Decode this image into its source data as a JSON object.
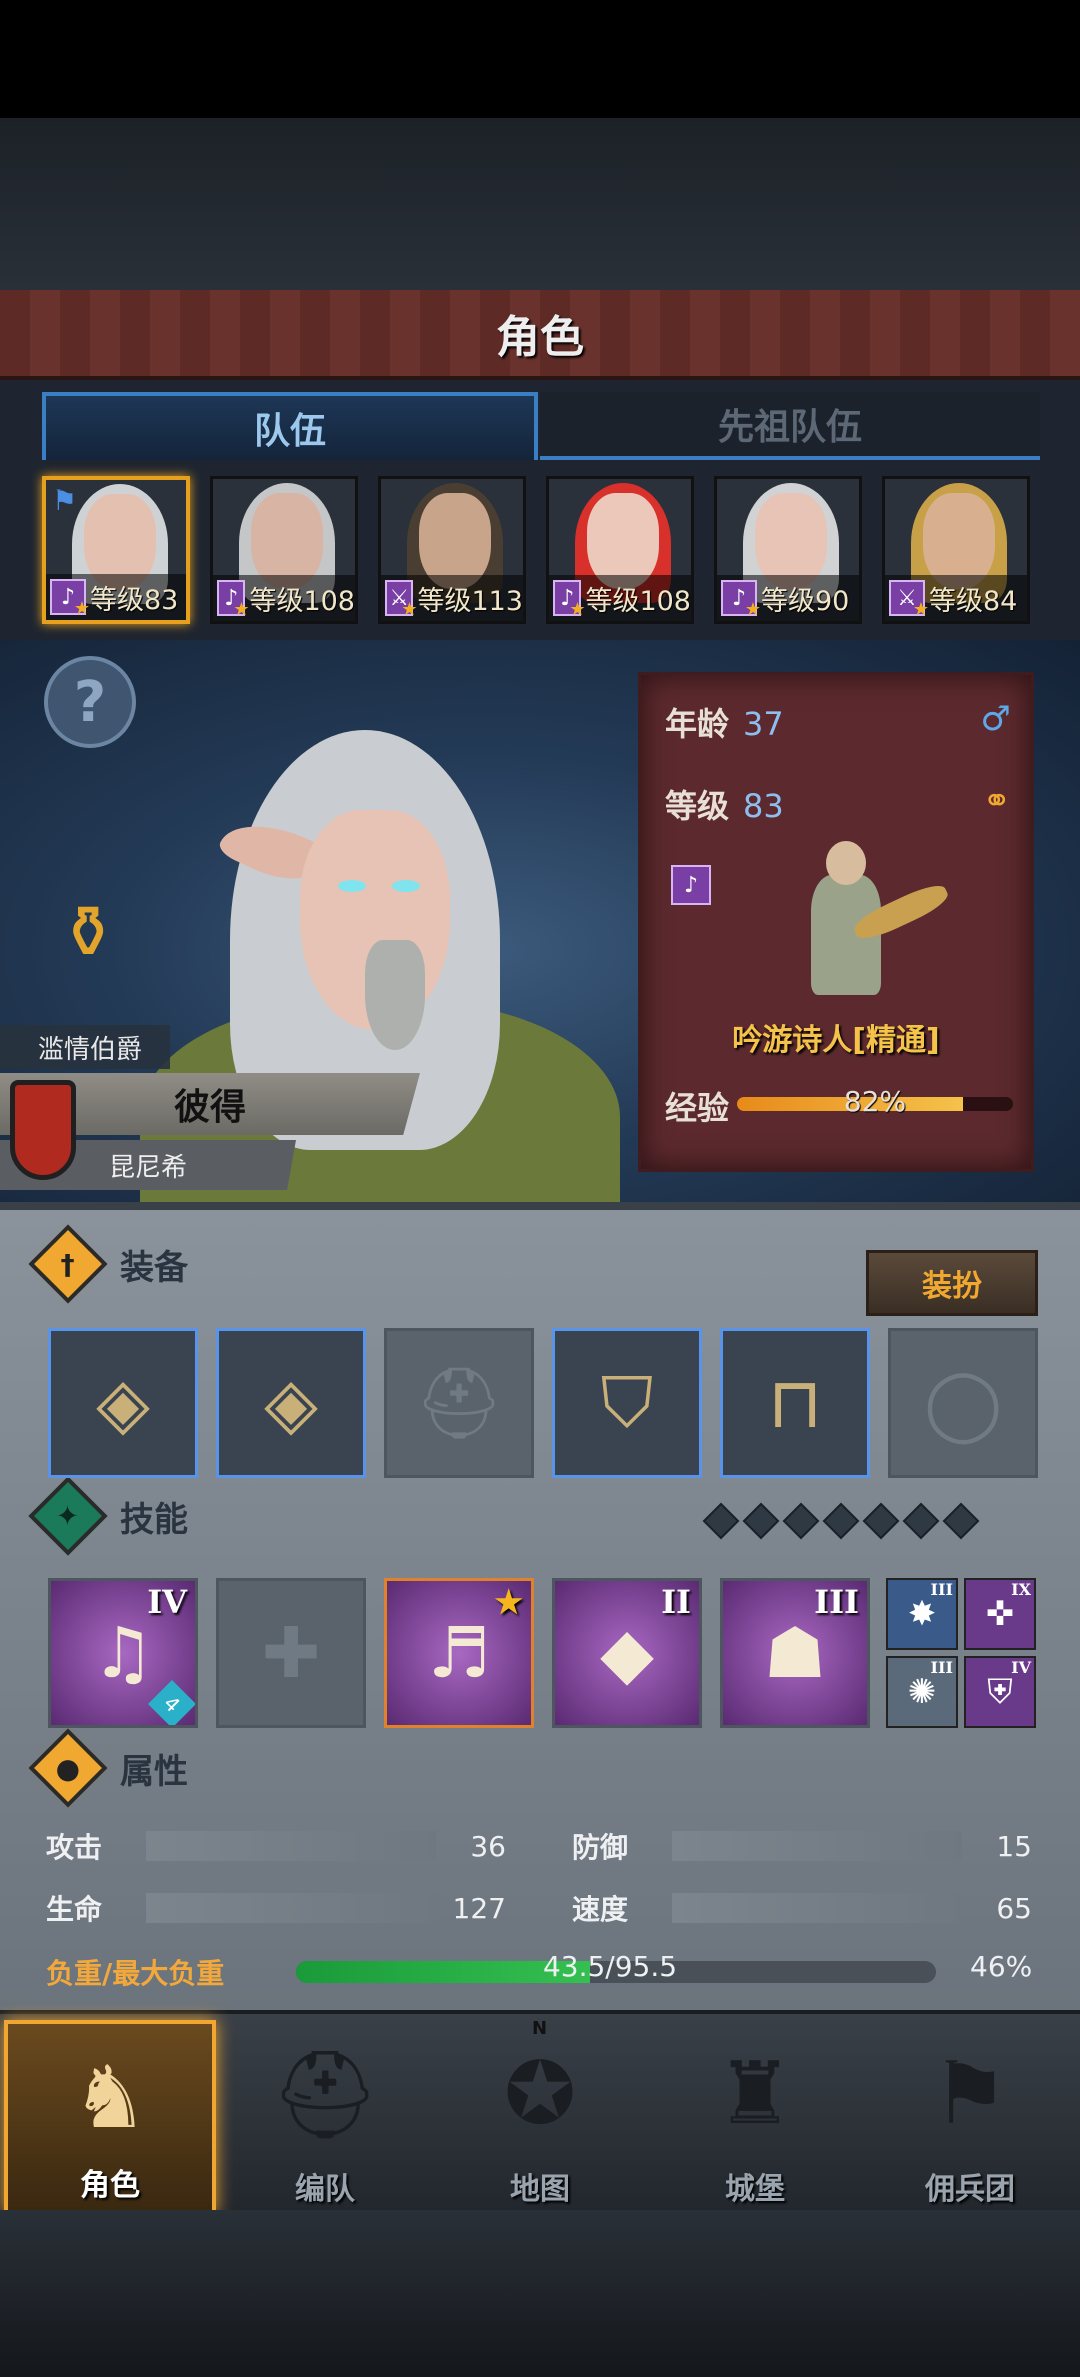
{
  "header": {
    "title": "角色"
  },
  "tabs": [
    {
      "label": "队伍",
      "active": true
    },
    {
      "label": "先祖队伍",
      "active": false
    }
  ],
  "party": [
    {
      "level": "等级83",
      "selected": true,
      "class_icon": "lute-icon",
      "starred": true,
      "hair": "#cfd2d4",
      "skin": "#e4c0b0",
      "flag": "flag-icon"
    },
    {
      "level": "等级108",
      "selected": false,
      "class_icon": "lute-icon",
      "starred": true,
      "hair": "#c4c6c8",
      "skin": "#d8b4a4"
    },
    {
      "level": "等级113",
      "selected": false,
      "class_icon": "sword-icon",
      "starred": true,
      "hair": "#4a3e32",
      "skin": "#c8a48a"
    },
    {
      "level": "等级108",
      "selected": false,
      "class_icon": "lute-icon",
      "starred": true,
      "hair": "#d8302a",
      "skin": "#ecc8ba"
    },
    {
      "level": "等级90",
      "selected": false,
      "class_icon": "lute-icon",
      "starred": true,
      "hair": "#d0d2d4",
      "skin": "#e8c4b6"
    },
    {
      "level": "等级84",
      "selected": false,
      "class_icon": "sword-icon",
      "starred": true,
      "hair": "#c8a048",
      "skin": "#d8b090"
    }
  ],
  "hero": {
    "title": "滥情伯爵",
    "name": "彼得",
    "subname": "昆尼希"
  },
  "info": {
    "age_label": "年龄",
    "age_value": "37",
    "level_label": "等级",
    "level_value": "83",
    "class_name": "吟游诗人[精通]",
    "exp_label": "经验",
    "exp_text": "82%",
    "exp_fraction": 0.82,
    "gender_icon": "male-icon",
    "ring_icon": "ring-icon"
  },
  "equipment": {
    "title": "装备",
    "dress_button": "装扮",
    "slots": [
      {
        "filled": true,
        "icon": "bracer-icon"
      },
      {
        "filled": true,
        "icon": "bracer-icon"
      },
      {
        "filled": false,
        "icon": "helmet-icon"
      },
      {
        "filled": true,
        "icon": "armor-icon"
      },
      {
        "filled": true,
        "icon": "boots-icon"
      },
      {
        "filled": false,
        "icon": "ring-icon"
      }
    ]
  },
  "skills": {
    "title": "技能",
    "main": [
      {
        "icon": "music-note-icon",
        "rank": "IV",
        "badge": "4"
      },
      {
        "icon": "empty-slot-icon",
        "rank": ""
      },
      {
        "icon": "crystal-note-icon",
        "rank": "",
        "starred": true
      },
      {
        "icon": "crystal-icon",
        "rank": "II"
      },
      {
        "icon": "crowd-icon",
        "rank": "III"
      }
    ],
    "small": [
      {
        "icon": "shield-burst-icon",
        "rank": "III"
      },
      {
        "icon": "target-icon",
        "rank": "IX"
      },
      {
        "icon": "burst-icon",
        "rank": "III"
      },
      {
        "icon": "shield-icon",
        "rank": "IV"
      }
    ],
    "slot_count": 7
  },
  "attributes": {
    "title": "属性",
    "stats": [
      {
        "label": "攻击",
        "value": "36"
      },
      {
        "label": "防御",
        "value": "15"
      },
      {
        "label": "生命",
        "value": "127"
      },
      {
        "label": "速度",
        "value": "65"
      }
    ],
    "load_label": "负重/最大负重",
    "load_text": "43.5/95.5",
    "load_pct": "46%",
    "load_fraction": 0.46
  },
  "nav": [
    {
      "label": "角色",
      "icon": "knight-icon",
      "active": true
    },
    {
      "label": "编队",
      "icon": "helmet-icon",
      "active": false
    },
    {
      "label": "地图",
      "icon": "compass-icon",
      "active": false
    },
    {
      "label": "城堡",
      "icon": "castle-icon",
      "active": false
    },
    {
      "label": "佣兵团",
      "icon": "banner-icon",
      "active": false
    }
  ],
  "compass_north": "N"
}
